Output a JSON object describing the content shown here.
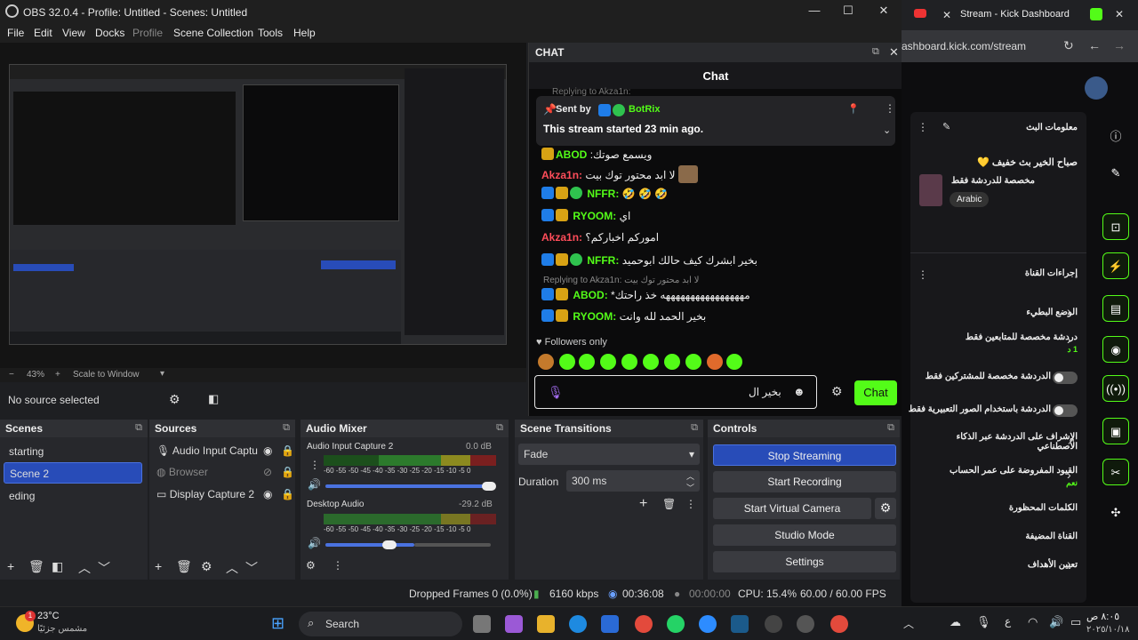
{
  "obs": {
    "title": "OBS 32.0.4 - Profile: Untitled - Scenes: Untitled",
    "menu": [
      "File",
      "Edit",
      "View",
      "Docks",
      "Profile",
      "Scene Collection",
      "Tools",
      "Help"
    ],
    "zoom": "43%",
    "scale_mode": "Scale to Window",
    "no_source": "No source selected",
    "scenes": {
      "title": "Scenes",
      "items": [
        "starting",
        "Scene 2",
        "eding"
      ],
      "selected": "Scene 2"
    },
    "sources": {
      "title": "Sources",
      "items": [
        "Audio Input Captu",
        "Browser",
        "Display Capture 2"
      ]
    },
    "audio_mixer": {
      "title": "Audio Mixer",
      "channels": [
        {
          "name": "Audio Input Capture 2",
          "db": "0.0 dB",
          "level": 0.68
        },
        {
          "name": "Desktop Audio",
          "db": "-29.2 dB",
          "level": 0.5
        }
      ],
      "ticks": "-60 -55 -50 -45 -40 -35 -30 -25 -20 -15 -10 -5  0"
    },
    "transitions": {
      "title": "Scene Transitions",
      "selected": "Fade",
      "duration_label": "Duration",
      "duration_value": "300 ms"
    },
    "controls": {
      "title": "Controls",
      "buttons": [
        "Stop Streaming",
        "Start Recording",
        "Start Virtual Camera",
        "Studio Mode",
        "Settings"
      ]
    },
    "status": {
      "dropped": "Dropped Frames 0 (0.0%)",
      "bitrate": "6160 kbps",
      "live_time": "00:36:08",
      "rec_time": "00:00:00",
      "cpu": "CPU: 15.4%",
      "fps": "60.00 / 60.00 FPS"
    }
  },
  "chat": {
    "dock_title": "CHAT",
    "header": "Chat",
    "reply_top": "Replying to Akza1n:",
    "pinned": {
      "sent_by": "Sent by",
      "user": "BotRix",
      "text": "This stream started 23 min ago."
    },
    "messages": [
      {
        "user": "ABOD",
        "text": ":ويسمع صوتك",
        "color": "gold"
      },
      {
        "user": "Akza1n",
        "text": "لا ابد محتور توك بيت",
        "color": "red"
      },
      {
        "user": "NFFR",
        "text": "🤣 🤣 🤣",
        "color": "green"
      },
      {
        "user": "RYOOM",
        "text": "اي",
        "color": "green"
      },
      {
        "user": "Akza1n",
        "text": "اموركم اخباركم؟",
        "color": "red"
      },
      {
        "user": "NFFR",
        "text": "بخير ابشرك كيف حالك ابوحميد",
        "color": "green"
      },
      {
        "user": "ABOD",
        "text": "*مههههههههههههههههه خذ راحتك",
        "color": "green"
      },
      {
        "user": "RYOOM",
        "text": "بخير الحمد لله وانت",
        "color": "green"
      }
    ],
    "reply_line": "Replying to Akza1n: لا ابد محتور توك بيت",
    "followers_only": "Followers only",
    "input_value": "بخير ال",
    "send_label": "Chat"
  },
  "browser": {
    "tab_title": "Stream - Kick Dashboard",
    "url": "ashboard.kick.com/stream",
    "stream_info_title": "معلومات البث",
    "stream_title": "صباح الخير بث خفيف 💛",
    "stream_subtitle": "مخصصة للدردشة فقط",
    "language": "Arabic",
    "channel_actions_title": "إجراءات القناة",
    "actions": [
      {
        "label": "الوضع البطيء",
        "type": "arrow"
      },
      {
        "label": "دردشة مخصصة للمتابعين فقط",
        "sub": "1 د",
        "type": "arrow"
      },
      {
        "label": "الدردشة مخصصة للمشتركين فقط",
        "type": "toggle"
      },
      {
        "label": "الدردشة باستخدام الصور التعبيرية فقط",
        "type": "toggle"
      },
      {
        "label": "الإشراف على الدردشة عبر الذكاء الاصطناعي",
        "type": "link"
      },
      {
        "label": "القيود المفروضة على عمر الحساب",
        "sub": "نعم",
        "type": "arrow"
      },
      {
        "label": "الكلمات المحظورة",
        "type": "arrow"
      },
      {
        "label": "القناة المضيفة",
        "type": "none"
      },
      {
        "label": "تعيين الأهداف",
        "type": "arrow"
      }
    ]
  },
  "taskbar": {
    "weather_temp": "23°C",
    "weather_desc": "مشمس جزئيًا",
    "badge": "1",
    "search": "Search",
    "time": "٨:٠٥ ص",
    "date": "٢٠٢٥/١٠/١٨"
  },
  "colors": {
    "kick_green": "#53fc18",
    "obs_select": "#284cb8"
  }
}
